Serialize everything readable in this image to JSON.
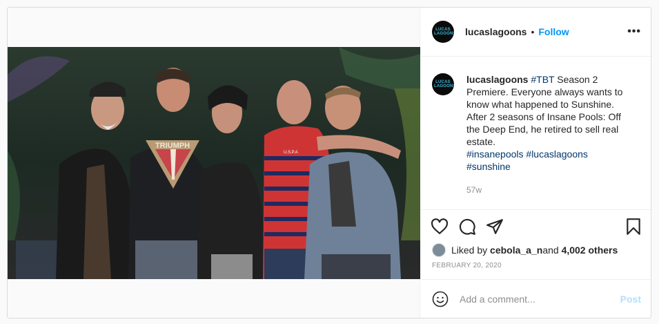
{
  "account": {
    "username": "lucaslagoons",
    "avatar_text": "LUCAS LAGOONS",
    "separator": "•",
    "follow_label": "Follow",
    "more_label": "•••"
  },
  "caption": {
    "username": "lucaslagoons",
    "hashtag_tbt": "#TBT",
    "text": " Season 2 Premiere. Everyone always wants to know what happened to Sunshine. After 2 seasons of Insane Pools: Off the Deep End, he retired to sell real estate.",
    "hashtags": [
      "#insanepools",
      "#lucaslagoons",
      "#sunshine"
    ],
    "age": "57w"
  },
  "likes": {
    "prefix": "Liked by ",
    "user": "cebola_a_n",
    "middle": " and ",
    "count": "4,002 others"
  },
  "date": "FEBRUARY 20, 2020",
  "comment": {
    "placeholder": "Add a comment...",
    "post_label": "Post"
  },
  "photo": {
    "shirt_logo_text": "TRIUMPH",
    "polo_text": "U.S.P.A"
  },
  "icons": [
    "heart-icon",
    "comment-icon",
    "share-icon",
    "bookmark-icon",
    "emoji-icon",
    "more-options-icon"
  ],
  "colors": {
    "follow": "#0095f6",
    "hashtag": "#00376b",
    "post_disabled": "#b2dffc",
    "muted": "#8e8e8e"
  }
}
